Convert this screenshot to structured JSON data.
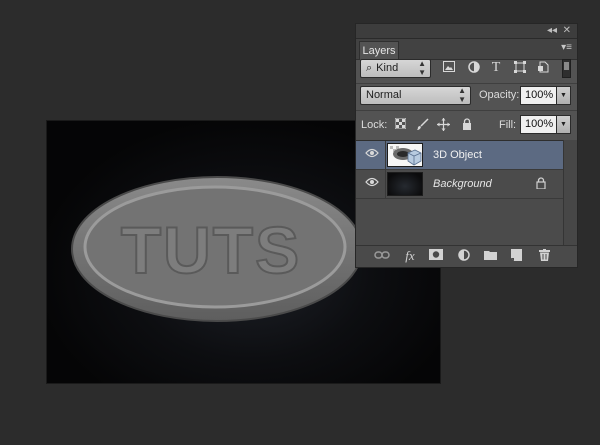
{
  "canvas": {
    "artwork_text": "TUTS"
  },
  "panel": {
    "collapse_glyph": "◂◂",
    "close_glyph": "✕",
    "tab_label": "Layers",
    "menu_glyph": "▾≡",
    "filter": {
      "kind_label": "Kind",
      "search_glyph": "⌕",
      "icons": [
        "image-filter-icon",
        "adjustment-filter-icon",
        "type-filter-icon",
        "shape-filter-icon",
        "smart-object-filter-icon"
      ]
    },
    "blend_mode": "Normal",
    "opacity_label": "Opacity:",
    "opacity_value": "100%",
    "lock_label": "Lock:",
    "fill_label": "Fill:",
    "fill_value": "100%",
    "layers": [
      {
        "name": "3D Object",
        "selected": true,
        "visible": true,
        "locked": false
      },
      {
        "name": "Background",
        "selected": false,
        "visible": true,
        "locked": true
      }
    ],
    "footer_icons": [
      "link-layers-icon",
      "fx-icon",
      "mask-icon",
      "adjustment-icon",
      "group-icon",
      "new-layer-icon",
      "delete-icon"
    ],
    "fx_label": "fx"
  },
  "colors": {
    "app_bg": "#2c2c2c",
    "panel_bg": "#535353",
    "selected_layer": "#5c6a82"
  }
}
